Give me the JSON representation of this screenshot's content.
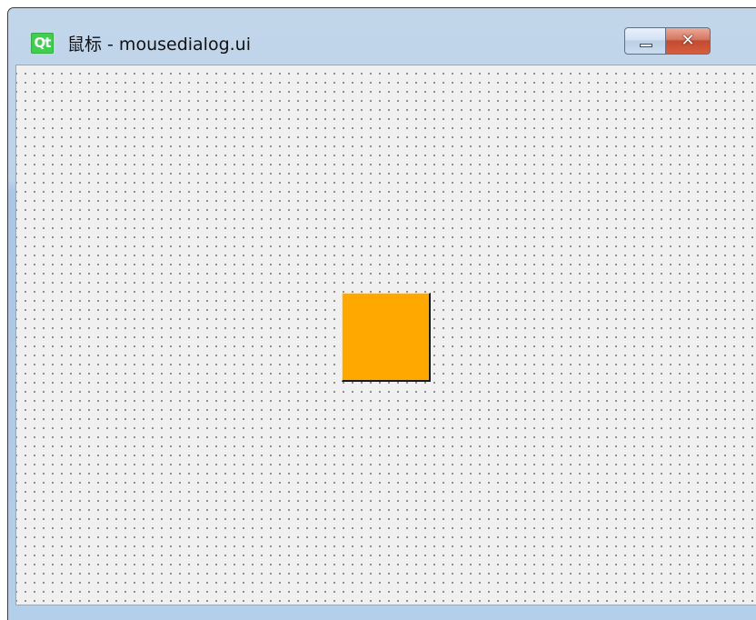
{
  "window": {
    "app_icon_label": "Qt",
    "title": "鼠标 - mousedialog.ui",
    "close_label": "✕"
  },
  "canvas": {
    "background": "#f0f0f0",
    "grid_dot_color": "#808080",
    "widget": {
      "color": "#ffa800",
      "style": "raised"
    }
  },
  "colors": {
    "titlebar": "#bcd3ea",
    "close_button": "#c24a2f",
    "qt_green": "#41cd52"
  },
  "icons": {
    "app": "qt-logo-icon",
    "minimize": "minimize-icon",
    "close": "close-icon"
  }
}
